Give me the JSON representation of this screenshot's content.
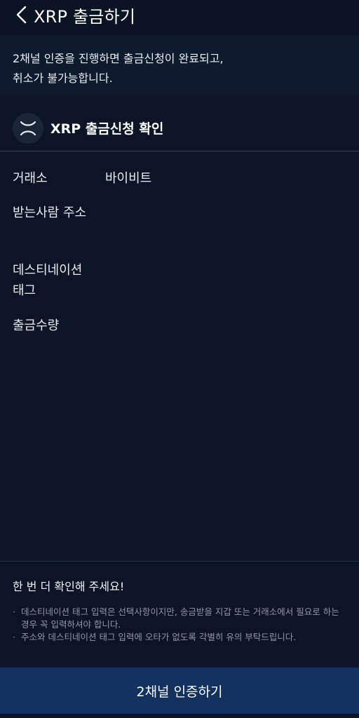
{
  "header": {
    "title": "XRP 출금하기",
    "back_icon": "chevron-left-icon"
  },
  "notice": {
    "line1": "2채널 인증을 진행하면 출금신청이 완료되고,",
    "line2": "취소가 불가능합니다."
  },
  "confirm": {
    "coin_icon": "xrp-logo-icon",
    "title": "XRP 출금신청 확인"
  },
  "fields": {
    "exchange_label": "거래소",
    "exchange_value": "바이비트",
    "address_label": "받는사람 주소",
    "address_value": "",
    "tag_label_line1": "데스티네이션",
    "tag_label_line2": "태그",
    "tag_value": "",
    "amount_label": "출금수량",
    "amount_value": ""
  },
  "check": {
    "title": "한 번 더 확인해 주세요!",
    "bullets": [
      "데스티네이션 태그 입력은 선택사항이지만, 송금받을 지갑 또는 거래소에서 필요로 하는 경우 꼭 입력하셔야 합니다.",
      "주소와 데스티네이션 태그 입력에 오타가 없도록 각별히 유의 부탁드립니다."
    ]
  },
  "footer": {
    "auth_button_label": "2채널 인증하기"
  },
  "colors": {
    "background": "#0b1526",
    "button": "#12315e",
    "text": "#e8ecf2",
    "muted": "#8d97a7"
  }
}
